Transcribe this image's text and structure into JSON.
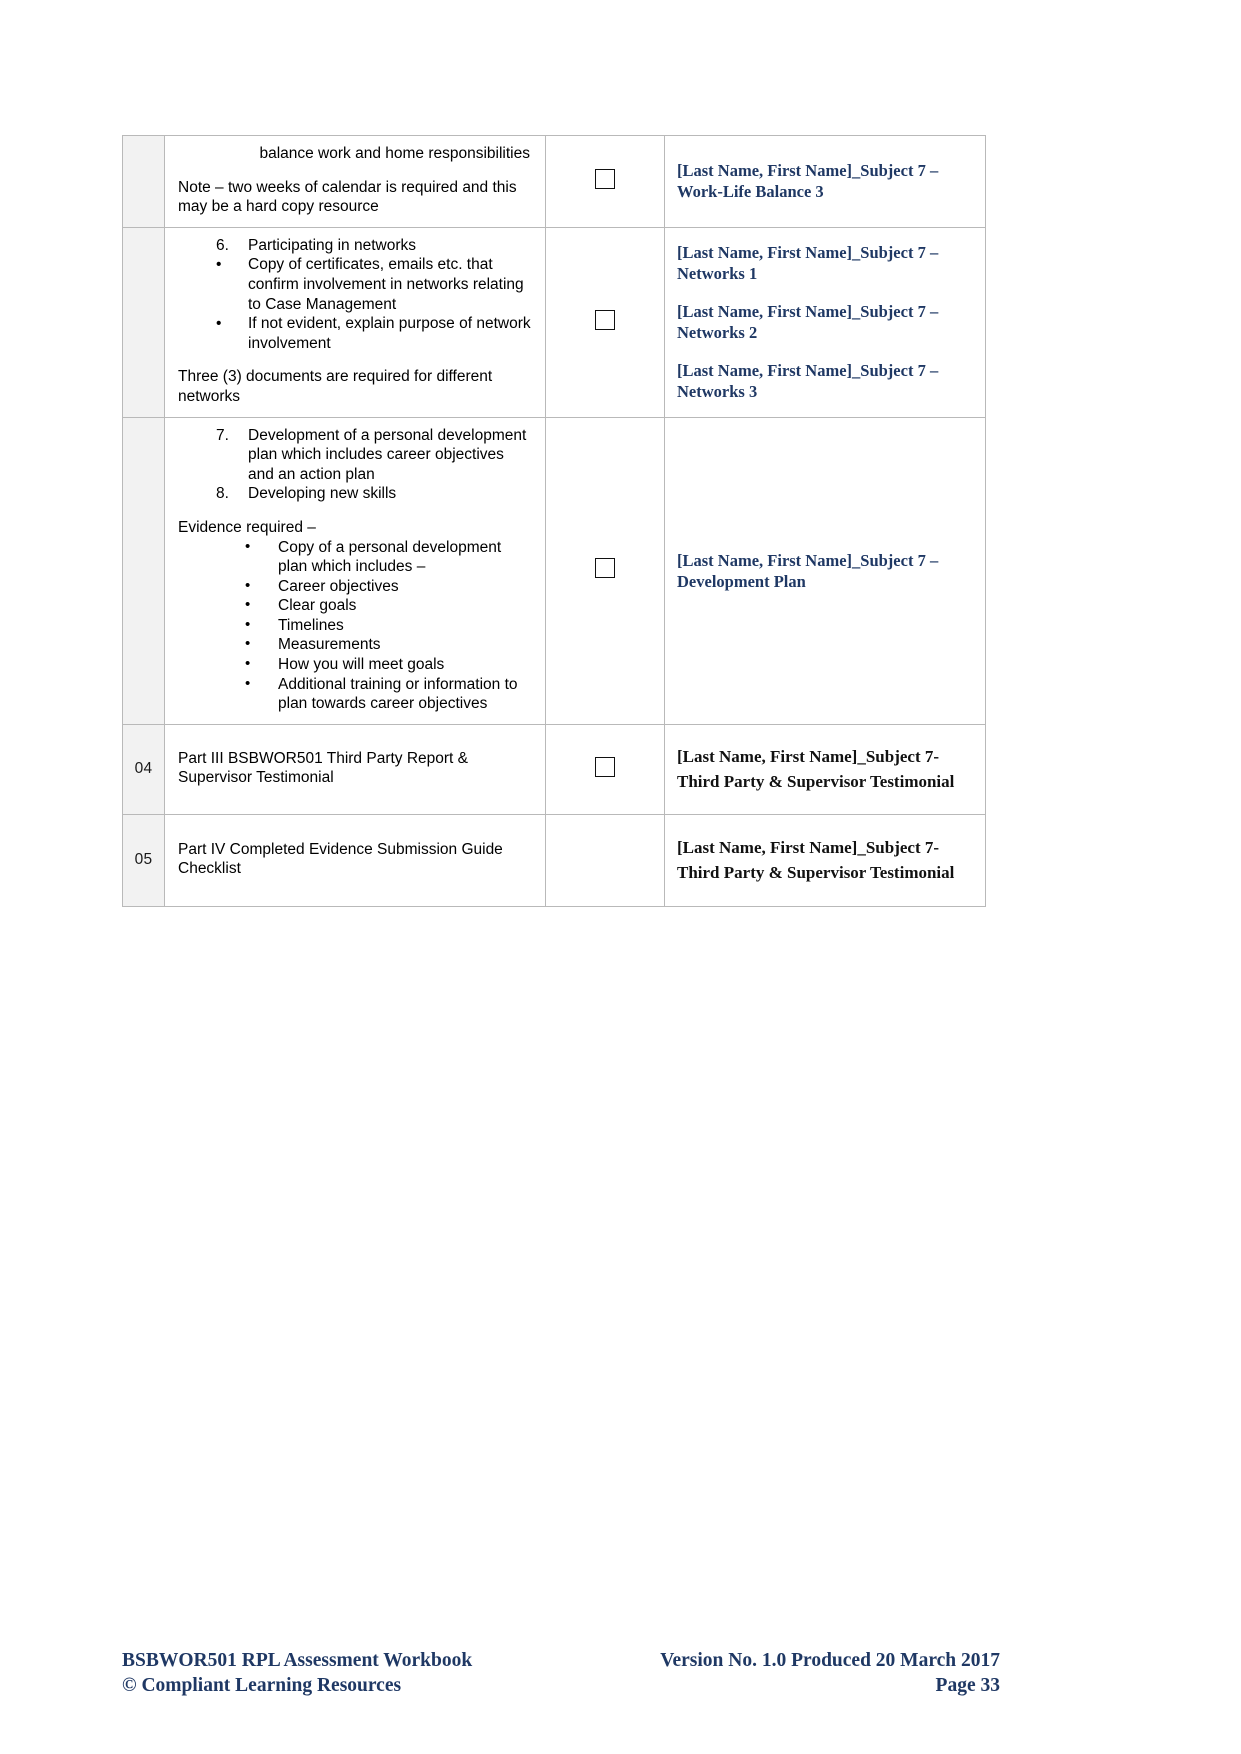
{
  "document": {
    "title": "BSBWOR501 RPL Assessment Workbook — Evidence Submission Guide Checklist"
  },
  "table": {
    "rows": [
      {
        "num": "",
        "desc": {
          "heading_cont": "balance work and home responsibilities",
          "note": "Note – two weeks of calendar is required and this may be a hard copy resource"
        },
        "checkbox": true,
        "files": [
          "[Last Name, First Name]_Subject 7 – Work-Life Balance 3"
        ],
        "file_style": "blue"
      },
      {
        "num": "",
        "desc": {
          "items": [
            {
              "marker": "6.",
              "text": "Participating in networks"
            },
            {
              "marker": "•",
              "text": "Copy of certificates, emails etc. that confirm involvement in networks relating to Case Management"
            },
            {
              "marker": "•",
              "text": "If not evident, explain purpose of network involvement"
            }
          ],
          "footnote": "Three (3) documents are required for different networks"
        },
        "checkbox": true,
        "files": [
          "[Last Name, First Name]_Subject 7 – Networks 1",
          "[Last Name, First Name]_Subject 7 – Networks 2",
          "[Last Name, First Name]_Subject 7 – Networks 3"
        ],
        "file_style": "blue"
      },
      {
        "num": "",
        "desc": {
          "numbered": [
            {
              "marker": "7.",
              "text": "Development of a personal development plan which includes career objectives and an action plan"
            },
            {
              "marker": "8.",
              "text": "Developing new skills"
            }
          ],
          "evidence_label": "Evidence required –",
          "bullets": [
            "Copy of a personal development plan which includes –",
            "Career objectives",
            "Clear goals",
            "Timelines",
            "Measurements",
            "How you will meet goals",
            "Additional training or information to plan towards career objectives"
          ]
        },
        "checkbox": true,
        "files": [
          "[Last Name, First Name]_Subject 7 – Development Plan"
        ],
        "file_style": "blue"
      },
      {
        "num": "04",
        "desc": {
          "plain": "Part III BSBWOR501 Third Party Report & Supervisor Testimonial"
        },
        "checkbox": true,
        "files": [
          "[Last Name, First Name]_Subject 7- Third Party & Supervisor Testimonial"
        ],
        "file_style": "black"
      },
      {
        "num": "05",
        "desc": {
          "plain": "Part IV Completed Evidence Submission Guide Checklist"
        },
        "checkbox": false,
        "files": [
          "[Last Name, First Name]_Subject 7- Third Party & Supervisor Testimonial"
        ],
        "file_style": "black"
      }
    ]
  },
  "footer": {
    "left_line1": "BSBWOR501 RPL Assessment Workbook",
    "left_line2": "© Compliant Learning Resources",
    "right_line1": "Version No. 1.0 Produced 20 March 2017",
    "right_line2": "Page 33"
  },
  "colors": {
    "heading_blue": "#1f3864",
    "rule_grey": "#b9b9b9",
    "num_cell_bg": "#f2f2f2"
  }
}
